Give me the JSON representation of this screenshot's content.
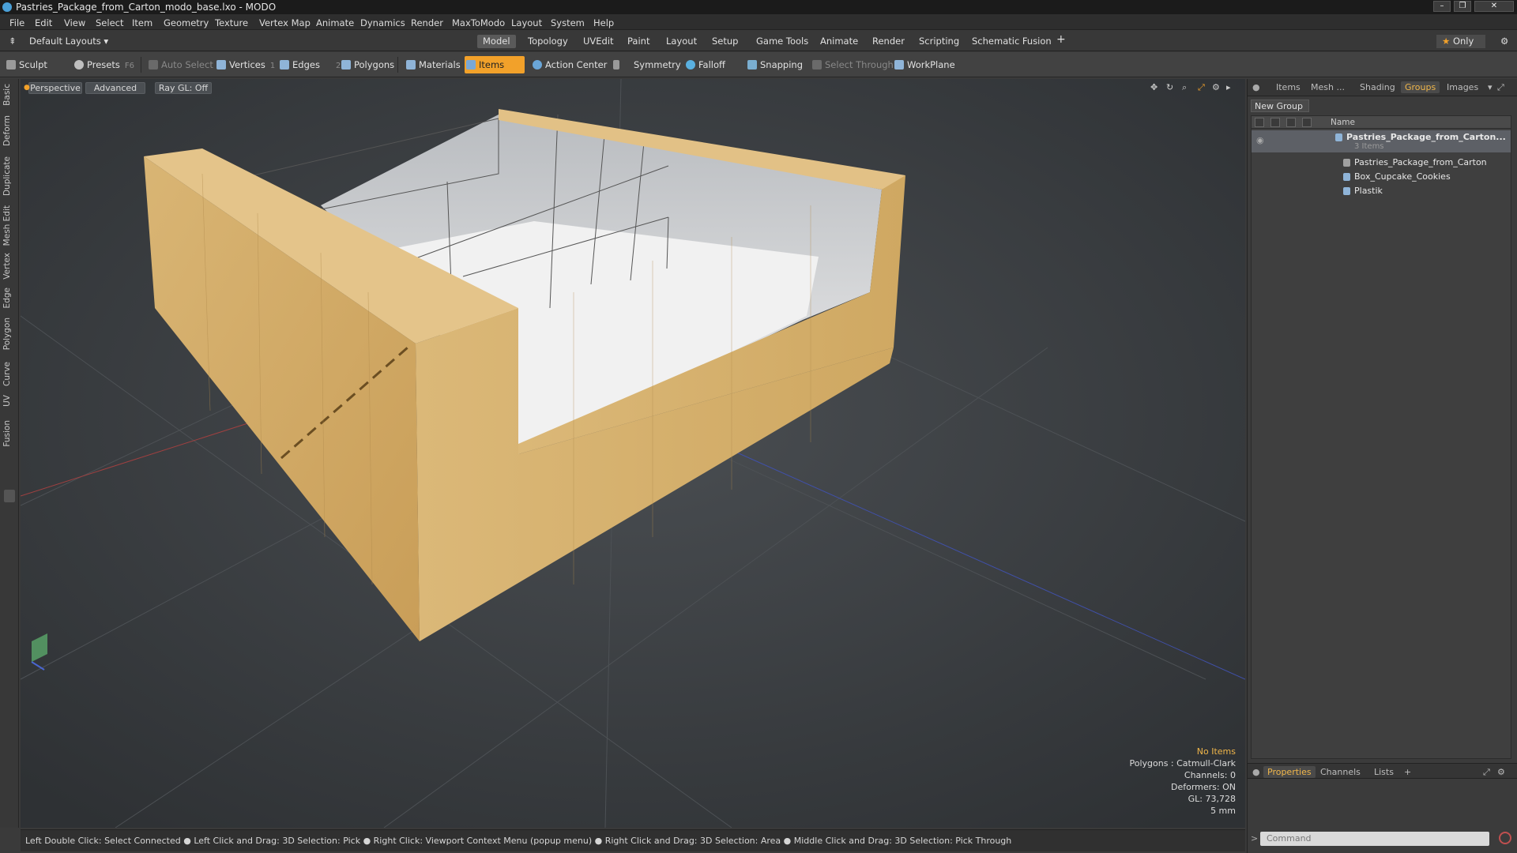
{
  "window": {
    "title": "Pastries_Package_from_Carton_modo_base.lxo - MODO"
  },
  "menu": [
    "File",
    "Edit",
    "View",
    "Select",
    "Item",
    "Geometry",
    "Texture",
    "Vertex Map",
    "Animate",
    "Dynamics",
    "Render",
    "MaxToModo",
    "Layout",
    "System",
    "Help"
  ],
  "layout": {
    "preset": "Default Layouts",
    "tabs": [
      "Model",
      "Topology",
      "UVEdit",
      "Paint",
      "Layout",
      "Setup",
      "Game Tools",
      "Animate",
      "Render",
      "Scripting",
      "Schematic Fusion"
    ],
    "active_tab": "Model",
    "only_label": "Only"
  },
  "toolbar": {
    "sculpt": "Sculpt",
    "presets": "Presets",
    "presets_key": "F6",
    "auto_select": "Auto Select",
    "vertices": "Vertices",
    "vertices_count": "1",
    "edges": "Edges",
    "edges_count": "2",
    "polygons": "Polygons",
    "materials": "Materials",
    "items": "Items",
    "action_center": "Action Center",
    "symmetry": "Symmetry",
    "falloff": "Falloff",
    "snapping": "Snapping",
    "select_through": "Select Through",
    "workplane": "WorkPlane"
  },
  "left_tabs": [
    "Basic",
    "Deform",
    "Duplicate",
    "Mesh Edit",
    "Vertex",
    "Edge",
    "Polygon",
    "Curve",
    "UV",
    "Fusion"
  ],
  "viewport": {
    "view": "Perspective",
    "mode": "Advanced",
    "raygl": "Ray GL: Off",
    "stats": {
      "items": "No Items",
      "polygons": "Polygons : Catmull-Clark",
      "channels": "Channels: 0",
      "deformers": "Deformers: ON",
      "gl": "GL: 73,728",
      "scale": "5 mm"
    }
  },
  "status": "Left Double Click: Select Connected ● Left Click and Drag: 3D Selection: Pick ● Right Click: Viewport Context Menu (popup menu) ● Right Click and Drag: 3D Selection: Area ● Middle Click and Drag: 3D Selection: Pick Through",
  "right_panel": {
    "tabs": [
      "Items",
      "Mesh ...",
      "Shading",
      "Groups",
      "Images"
    ],
    "active_tab": "Groups",
    "new_group": "New Group",
    "column_name": "Name",
    "group": {
      "name": "Pastries_Package_from_Carton...",
      "count": "3 Items"
    },
    "children": [
      "Pastries_Package_from_Carton",
      "Box_Cupcake_Cookies",
      "Plastik"
    ],
    "bottom_tabs": [
      "Properties",
      "Channels",
      "Lists"
    ],
    "command_placeholder": "Command"
  },
  "colors": {
    "accent": "#f2a12a",
    "viewport_bg": "#3d4043",
    "carton": "#d8b070"
  }
}
